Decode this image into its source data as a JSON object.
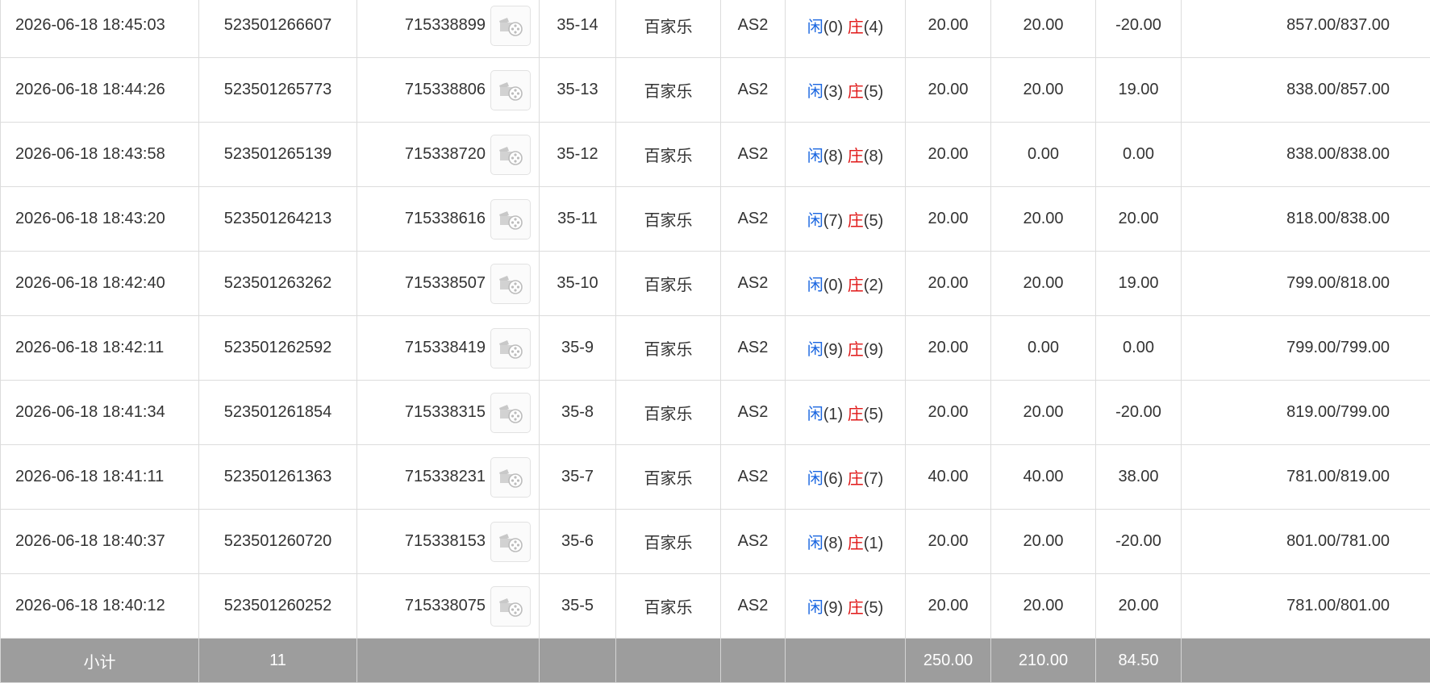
{
  "colors": {
    "player": "#1a66e0",
    "banker": "#e01818",
    "bet": "#1a66e0",
    "negative": "#e01818",
    "subtotal_bg": "#9d9d9d"
  },
  "replay_icon": "film-reel-icon",
  "rows": [
    {
      "time": "2026-06-18 18:45:03",
      "bet_no": "523501266607",
      "round_no": "715338899",
      "shoe": "35-14",
      "game": "百家乐",
      "table": "AS2",
      "player_label": "闲",
      "player_val": "(0)",
      "banker_label": "庄",
      "banker_val": "(4)",
      "bet": "20.00",
      "valid": "20.00",
      "winloss": "-20.00",
      "balance": "857.00/837.00"
    },
    {
      "time": "2026-06-18 18:44:26",
      "bet_no": "523501265773",
      "round_no": "715338806",
      "shoe": "35-13",
      "game": "百家乐",
      "table": "AS2",
      "player_label": "闲",
      "player_val": "(3)",
      "banker_label": "庄",
      "banker_val": "(5)",
      "bet": "20.00",
      "valid": "20.00",
      "winloss": "19.00",
      "balance": "838.00/857.00"
    },
    {
      "time": "2026-06-18 18:43:58",
      "bet_no": "523501265139",
      "round_no": "715338720",
      "shoe": "35-12",
      "game": "百家乐",
      "table": "AS2",
      "player_label": "闲",
      "player_val": "(8)",
      "banker_label": "庄",
      "banker_val": "(8)",
      "bet": "20.00",
      "valid": "0.00",
      "winloss": "0.00",
      "balance": "838.00/838.00"
    },
    {
      "time": "2026-06-18 18:43:20",
      "bet_no": "523501264213",
      "round_no": "715338616",
      "shoe": "35-11",
      "game": "百家乐",
      "table": "AS2",
      "player_label": "闲",
      "player_val": "(7)",
      "banker_label": "庄",
      "banker_val": "(5)",
      "bet": "20.00",
      "valid": "20.00",
      "winloss": "20.00",
      "balance": "818.00/838.00"
    },
    {
      "time": "2026-06-18 18:42:40",
      "bet_no": "523501263262",
      "round_no": "715338507",
      "shoe": "35-10",
      "game": "百家乐",
      "table": "AS2",
      "player_label": "闲",
      "player_val": "(0)",
      "banker_label": "庄",
      "banker_val": "(2)",
      "bet": "20.00",
      "valid": "20.00",
      "winloss": "19.00",
      "balance": "799.00/818.00"
    },
    {
      "time": "2026-06-18 18:42:11",
      "bet_no": "523501262592",
      "round_no": "715338419",
      "shoe": "35-9",
      "game": "百家乐",
      "table": "AS2",
      "player_label": "闲",
      "player_val": "(9)",
      "banker_label": "庄",
      "banker_val": "(9)",
      "bet": "20.00",
      "valid": "0.00",
      "winloss": "0.00",
      "balance": "799.00/799.00"
    },
    {
      "time": "2026-06-18 18:41:34",
      "bet_no": "523501261854",
      "round_no": "715338315",
      "shoe": "35-8",
      "game": "百家乐",
      "table": "AS2",
      "player_label": "闲",
      "player_val": "(1)",
      "banker_label": "庄",
      "banker_val": "(5)",
      "bet": "20.00",
      "valid": "20.00",
      "winloss": "-20.00",
      "balance": "819.00/799.00"
    },
    {
      "time": "2026-06-18 18:41:11",
      "bet_no": "523501261363",
      "round_no": "715338231",
      "shoe": "35-7",
      "game": "百家乐",
      "table": "AS2",
      "player_label": "闲",
      "player_val": "(6)",
      "banker_label": "庄",
      "banker_val": "(7)",
      "bet": "40.00",
      "valid": "40.00",
      "winloss": "38.00",
      "balance": "781.00/819.00"
    },
    {
      "time": "2026-06-18 18:40:37",
      "bet_no": "523501260720",
      "round_no": "715338153",
      "shoe": "35-6",
      "game": "百家乐",
      "table": "AS2",
      "player_label": "闲",
      "player_val": "(8)",
      "banker_label": "庄",
      "banker_val": "(1)",
      "bet": "20.00",
      "valid": "20.00",
      "winloss": "-20.00",
      "balance": "801.00/781.00"
    },
    {
      "time": "2026-06-18 18:40:12",
      "bet_no": "523501260252",
      "round_no": "715338075",
      "shoe": "35-5",
      "game": "百家乐",
      "table": "AS2",
      "player_label": "闲",
      "player_val": "(9)",
      "banker_label": "庄",
      "banker_val": "(5)",
      "bet": "20.00",
      "valid": "20.00",
      "winloss": "20.00",
      "balance": "781.00/801.00"
    }
  ],
  "subtotal": {
    "label": "小计",
    "count": "11",
    "bet": "250.00",
    "valid": "210.00",
    "winloss": "84.50"
  }
}
